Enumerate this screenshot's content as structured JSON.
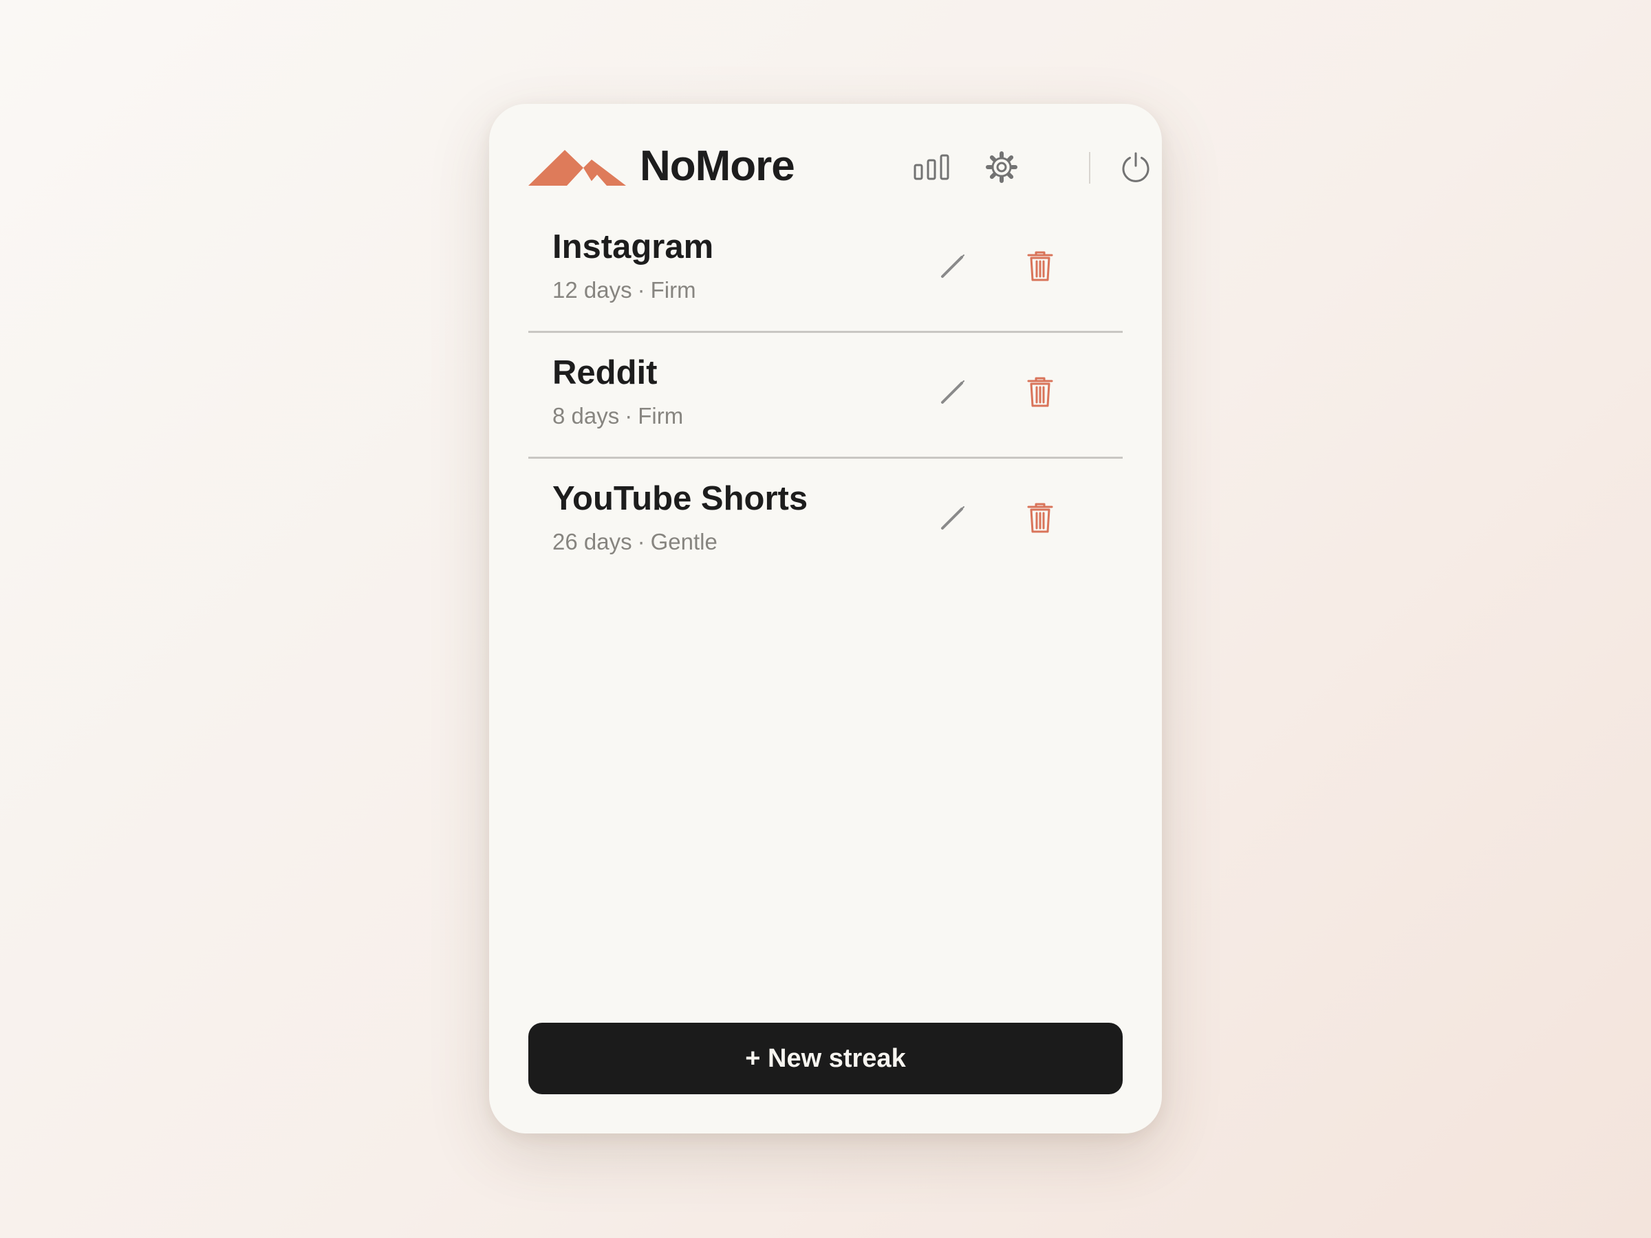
{
  "app": {
    "title": "NoMore",
    "brand_color": "#de7b5a",
    "logo_icon": "mountains-logo-icon"
  },
  "header": {
    "actions": [
      {
        "name": "stats",
        "icon": "bar-chart-icon"
      },
      {
        "name": "settings",
        "icon": "gear-icon"
      },
      {
        "name": "power",
        "icon": "power-icon"
      }
    ]
  },
  "streaks": [
    {
      "name": "Instagram",
      "days": "12 days",
      "separator": "·",
      "mode": "Firm"
    },
    {
      "name": "Reddit",
      "days": "8 days",
      "separator": "·",
      "mode": "Firm"
    },
    {
      "name": "YouTube Shorts",
      "days": "26 days",
      "separator": "·",
      "mode": "Gentle"
    }
  ],
  "row_actions": {
    "edit_icon": "pencil-icon",
    "delete_icon": "trash-icon",
    "delete_color": "#d9745a"
  },
  "footer": {
    "new_button_label": "+ New streak"
  }
}
